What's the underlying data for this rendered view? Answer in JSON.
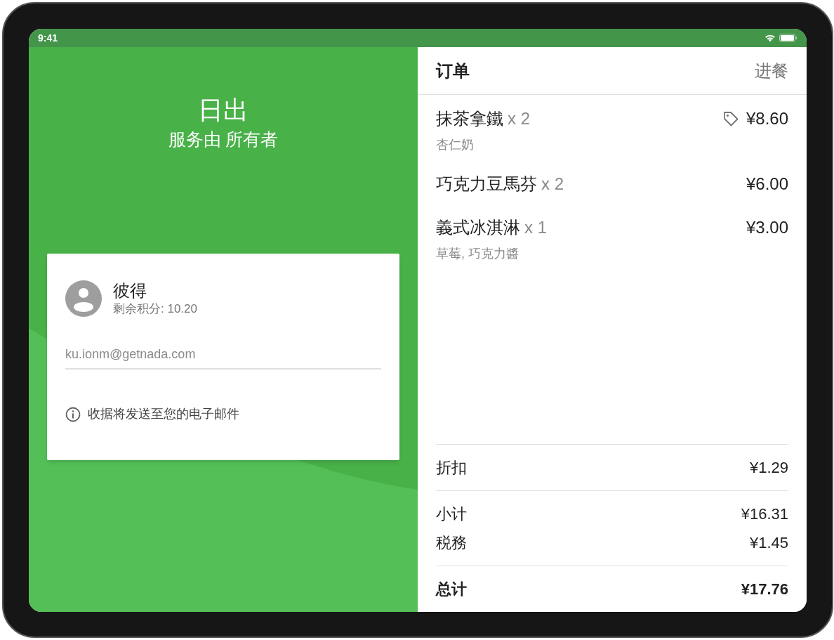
{
  "status_bar": {
    "time": "9:41"
  },
  "store": {
    "name": "日出",
    "subtitle": "服务由 所有者"
  },
  "customer": {
    "name": "彼得",
    "points": "剩余积分: 10.20",
    "email": "ku.ionm@getnada.com",
    "note": "收据将发送至您的电子邮件"
  },
  "order": {
    "title": "订单",
    "mode": "进餐",
    "items": [
      {
        "name": "抹茶拿鐵",
        "qty": "x 2",
        "price": "¥8.60",
        "tagged": true,
        "options": "杏仁奶"
      },
      {
        "name": "巧克力豆馬芬",
        "qty": "x 2",
        "price": "¥6.00",
        "tagged": false
      },
      {
        "name": "義式冰淇淋",
        "qty": "x 1",
        "price": "¥3.00",
        "tagged": false,
        "options": "草莓, 巧克力醬"
      }
    ],
    "summary": [
      {
        "label": "折扣",
        "value": "¥1.29",
        "kind": "discount"
      },
      {
        "label": "小计",
        "value": "¥16.31",
        "kind": "subtotal"
      },
      {
        "label": "税務",
        "value": "¥1.45",
        "kind": "tax"
      },
      {
        "label": "总计",
        "value": "¥17.76",
        "kind": "total"
      }
    ]
  }
}
